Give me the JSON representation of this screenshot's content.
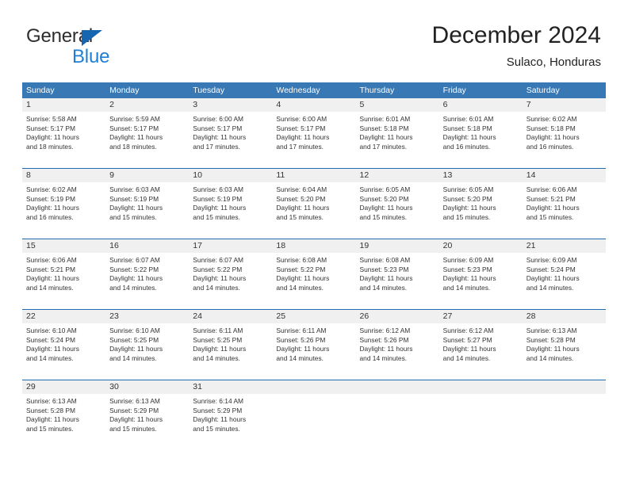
{
  "logo": {
    "word_one": "General",
    "word_two": "Blue",
    "triangle_icon": "blue-triangle-icon"
  },
  "header": {
    "title": "December 2024",
    "subtitle": "Sulaco, Honduras"
  },
  "colors": {
    "header_blue": "#3878b4",
    "rule_blue": "#1f6cb0",
    "daynum_band": "#f0f0f0",
    "logo_blue": "#1f7fd4",
    "text": "#333333"
  },
  "calendar": {
    "weekday_headers": [
      "Sunday",
      "Monday",
      "Tuesday",
      "Wednesday",
      "Thursday",
      "Friday",
      "Saturday"
    ],
    "weeks": [
      [
        {
          "day": "1",
          "sunrise": "Sunrise: 5:58 AM",
          "sunset": "Sunset: 5:17 PM",
          "daylight_1": "Daylight: 11 hours",
          "daylight_2": "and 18 minutes."
        },
        {
          "day": "2",
          "sunrise": "Sunrise: 5:59 AM",
          "sunset": "Sunset: 5:17 PM",
          "daylight_1": "Daylight: 11 hours",
          "daylight_2": "and 18 minutes."
        },
        {
          "day": "3",
          "sunrise": "Sunrise: 6:00 AM",
          "sunset": "Sunset: 5:17 PM",
          "daylight_1": "Daylight: 11 hours",
          "daylight_2": "and 17 minutes."
        },
        {
          "day": "4",
          "sunrise": "Sunrise: 6:00 AM",
          "sunset": "Sunset: 5:17 PM",
          "daylight_1": "Daylight: 11 hours",
          "daylight_2": "and 17 minutes."
        },
        {
          "day": "5",
          "sunrise": "Sunrise: 6:01 AM",
          "sunset": "Sunset: 5:18 PM",
          "daylight_1": "Daylight: 11 hours",
          "daylight_2": "and 17 minutes."
        },
        {
          "day": "6",
          "sunrise": "Sunrise: 6:01 AM",
          "sunset": "Sunset: 5:18 PM",
          "daylight_1": "Daylight: 11 hours",
          "daylight_2": "and 16 minutes."
        },
        {
          "day": "7",
          "sunrise": "Sunrise: 6:02 AM",
          "sunset": "Sunset: 5:18 PM",
          "daylight_1": "Daylight: 11 hours",
          "daylight_2": "and 16 minutes."
        }
      ],
      [
        {
          "day": "8",
          "sunrise": "Sunrise: 6:02 AM",
          "sunset": "Sunset: 5:19 PM",
          "daylight_1": "Daylight: 11 hours",
          "daylight_2": "and 16 minutes."
        },
        {
          "day": "9",
          "sunrise": "Sunrise: 6:03 AM",
          "sunset": "Sunset: 5:19 PM",
          "daylight_1": "Daylight: 11 hours",
          "daylight_2": "and 15 minutes."
        },
        {
          "day": "10",
          "sunrise": "Sunrise: 6:03 AM",
          "sunset": "Sunset: 5:19 PM",
          "daylight_1": "Daylight: 11 hours",
          "daylight_2": "and 15 minutes."
        },
        {
          "day": "11",
          "sunrise": "Sunrise: 6:04 AM",
          "sunset": "Sunset: 5:20 PM",
          "daylight_1": "Daylight: 11 hours",
          "daylight_2": "and 15 minutes."
        },
        {
          "day": "12",
          "sunrise": "Sunrise: 6:05 AM",
          "sunset": "Sunset: 5:20 PM",
          "daylight_1": "Daylight: 11 hours",
          "daylight_2": "and 15 minutes."
        },
        {
          "day": "13",
          "sunrise": "Sunrise: 6:05 AM",
          "sunset": "Sunset: 5:20 PM",
          "daylight_1": "Daylight: 11 hours",
          "daylight_2": "and 15 minutes."
        },
        {
          "day": "14",
          "sunrise": "Sunrise: 6:06 AM",
          "sunset": "Sunset: 5:21 PM",
          "daylight_1": "Daylight: 11 hours",
          "daylight_2": "and 15 minutes."
        }
      ],
      [
        {
          "day": "15",
          "sunrise": "Sunrise: 6:06 AM",
          "sunset": "Sunset: 5:21 PM",
          "daylight_1": "Daylight: 11 hours",
          "daylight_2": "and 14 minutes."
        },
        {
          "day": "16",
          "sunrise": "Sunrise: 6:07 AM",
          "sunset": "Sunset: 5:22 PM",
          "daylight_1": "Daylight: 11 hours",
          "daylight_2": "and 14 minutes."
        },
        {
          "day": "17",
          "sunrise": "Sunrise: 6:07 AM",
          "sunset": "Sunset: 5:22 PM",
          "daylight_1": "Daylight: 11 hours",
          "daylight_2": "and 14 minutes."
        },
        {
          "day": "18",
          "sunrise": "Sunrise: 6:08 AM",
          "sunset": "Sunset: 5:22 PM",
          "daylight_1": "Daylight: 11 hours",
          "daylight_2": "and 14 minutes."
        },
        {
          "day": "19",
          "sunrise": "Sunrise: 6:08 AM",
          "sunset": "Sunset: 5:23 PM",
          "daylight_1": "Daylight: 11 hours",
          "daylight_2": "and 14 minutes."
        },
        {
          "day": "20",
          "sunrise": "Sunrise: 6:09 AM",
          "sunset": "Sunset: 5:23 PM",
          "daylight_1": "Daylight: 11 hours",
          "daylight_2": "and 14 minutes."
        },
        {
          "day": "21",
          "sunrise": "Sunrise: 6:09 AM",
          "sunset": "Sunset: 5:24 PM",
          "daylight_1": "Daylight: 11 hours",
          "daylight_2": "and 14 minutes."
        }
      ],
      [
        {
          "day": "22",
          "sunrise": "Sunrise: 6:10 AM",
          "sunset": "Sunset: 5:24 PM",
          "daylight_1": "Daylight: 11 hours",
          "daylight_2": "and 14 minutes."
        },
        {
          "day": "23",
          "sunrise": "Sunrise: 6:10 AM",
          "sunset": "Sunset: 5:25 PM",
          "daylight_1": "Daylight: 11 hours",
          "daylight_2": "and 14 minutes."
        },
        {
          "day": "24",
          "sunrise": "Sunrise: 6:11 AM",
          "sunset": "Sunset: 5:25 PM",
          "daylight_1": "Daylight: 11 hours",
          "daylight_2": "and 14 minutes."
        },
        {
          "day": "25",
          "sunrise": "Sunrise: 6:11 AM",
          "sunset": "Sunset: 5:26 PM",
          "daylight_1": "Daylight: 11 hours",
          "daylight_2": "and 14 minutes."
        },
        {
          "day": "26",
          "sunrise": "Sunrise: 6:12 AM",
          "sunset": "Sunset: 5:26 PM",
          "daylight_1": "Daylight: 11 hours",
          "daylight_2": "and 14 minutes."
        },
        {
          "day": "27",
          "sunrise": "Sunrise: 6:12 AM",
          "sunset": "Sunset: 5:27 PM",
          "daylight_1": "Daylight: 11 hours",
          "daylight_2": "and 14 minutes."
        },
        {
          "day": "28",
          "sunrise": "Sunrise: 6:13 AM",
          "sunset": "Sunset: 5:28 PM",
          "daylight_1": "Daylight: 11 hours",
          "daylight_2": "and 14 minutes."
        }
      ],
      [
        {
          "day": "29",
          "sunrise": "Sunrise: 6:13 AM",
          "sunset": "Sunset: 5:28 PM",
          "daylight_1": "Daylight: 11 hours",
          "daylight_2": "and 15 minutes."
        },
        {
          "day": "30",
          "sunrise": "Sunrise: 6:13 AM",
          "sunset": "Sunset: 5:29 PM",
          "daylight_1": "Daylight: 11 hours",
          "daylight_2": "and 15 minutes."
        },
        {
          "day": "31",
          "sunrise": "Sunrise: 6:14 AM",
          "sunset": "Sunset: 5:29 PM",
          "daylight_1": "Daylight: 11 hours",
          "daylight_2": "and 15 minutes."
        },
        {
          "day": "",
          "sunrise": "",
          "sunset": "",
          "daylight_1": "",
          "daylight_2": ""
        },
        {
          "day": "",
          "sunrise": "",
          "sunset": "",
          "daylight_1": "",
          "daylight_2": ""
        },
        {
          "day": "",
          "sunrise": "",
          "sunset": "",
          "daylight_1": "",
          "daylight_2": ""
        },
        {
          "day": "",
          "sunrise": "",
          "sunset": "",
          "daylight_1": "",
          "daylight_2": ""
        }
      ]
    ]
  }
}
